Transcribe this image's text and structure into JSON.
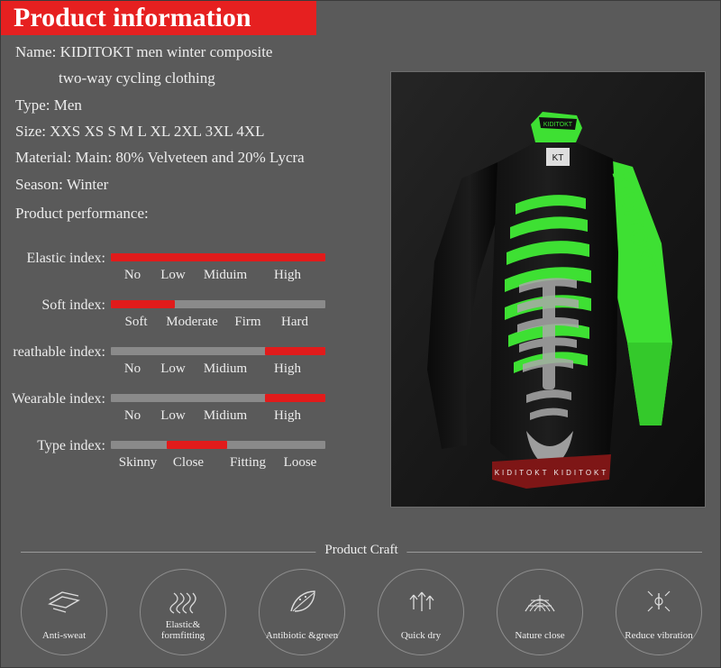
{
  "header": {
    "title": "Product information"
  },
  "specs": [
    {
      "text": "Name: KIDITOKT men winter composite",
      "indent": false
    },
    {
      "text": "two-way cycling clothing",
      "indent": true
    },
    {
      "text": "Type: Men",
      "indent": false
    },
    {
      "text": "Size: XXS XS S M L XL 2XL 3XL 4XL",
      "indent": false
    },
    {
      "text": "Material: Main: 80% Velveteen and 20% Lycra",
      "indent": false
    },
    {
      "text": "Season: Winter",
      "indent": false
    }
  ],
  "performance_heading": "Product performance:",
  "indices": [
    {
      "label": "Elastic index:",
      "fill_percent": 100,
      "fill_start": 0,
      "ticks": [
        "No",
        "Low",
        "Miduim",
        "High"
      ]
    },
    {
      "label": "Soft index:",
      "fill_percent": 30,
      "fill_start": 0,
      "ticks": [
        "Soft",
        "Moderate",
        "Firm",
        "Hard"
      ]
    },
    {
      "label": "reathable index:",
      "fill_percent": 28,
      "fill_start": 72,
      "ticks": [
        "No",
        "Low",
        "Midium",
        "High"
      ]
    },
    {
      "label": "Wearable index:",
      "fill_percent": 28,
      "fill_start": 72,
      "ticks": [
        "No",
        "Low",
        "Midium",
        "High"
      ]
    },
    {
      "label": "Type index:",
      "fill_percent": 28,
      "fill_start": 26,
      "ticks": [
        "Skinny",
        "Close",
        "Fitting",
        "Loose"
      ]
    }
  ],
  "photo": {
    "alt": "product-photo-cycling-jersey",
    "brand_text": "KIDITOKT",
    "hem_text": "KIDITOKT  KIDITOKT  KIDITOKT"
  },
  "craft": {
    "title": "Product Craft",
    "items": [
      {
        "label": "Anti-sweat",
        "icon": "fabric-layers-icon"
      },
      {
        "label": "Elastic&\nformfitting",
        "icon": "stretch-lines-icon"
      },
      {
        "label": "Antibiotic\n&green",
        "icon": "leaf-icon"
      },
      {
        "label": "Quick dry",
        "icon": "evaporation-arrows-icon"
      },
      {
        "label": "Nature close",
        "icon": "web-net-icon"
      },
      {
        "label": "Reduce\nvibration",
        "icon": "vibration-icon"
      }
    ]
  },
  "colors": {
    "accent_red": "#e62020",
    "bar_red": "#e11b1b",
    "bar_track": "#8a8a8a",
    "background": "#5a5a5a",
    "photo_bg": "#1a1a1a",
    "jersey_green": "#3ee033"
  }
}
